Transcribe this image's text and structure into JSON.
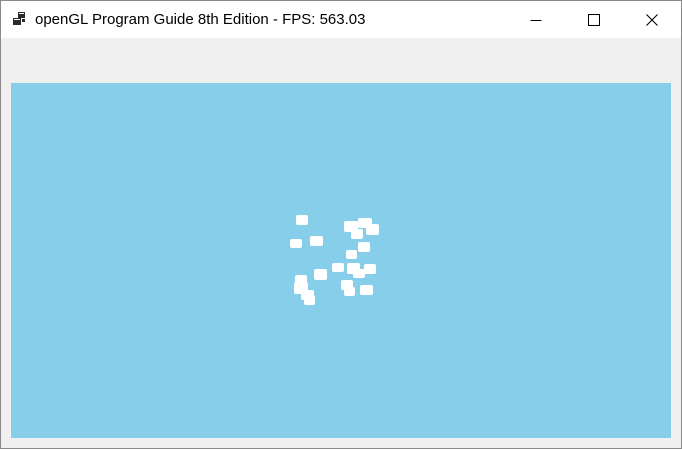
{
  "window": {
    "title": "openGL Program Guide 8th Edition - FPS: 563.03",
    "app_icon": "app-window-icon",
    "controls": {
      "minimize_icon": "minimize-icon",
      "maximize_icon": "maximize-icon",
      "close_icon": "close-icon"
    }
  },
  "viewport": {
    "clear_color": "#87ceeb",
    "particle_color": "#ffffff",
    "particle_count": 22
  }
}
